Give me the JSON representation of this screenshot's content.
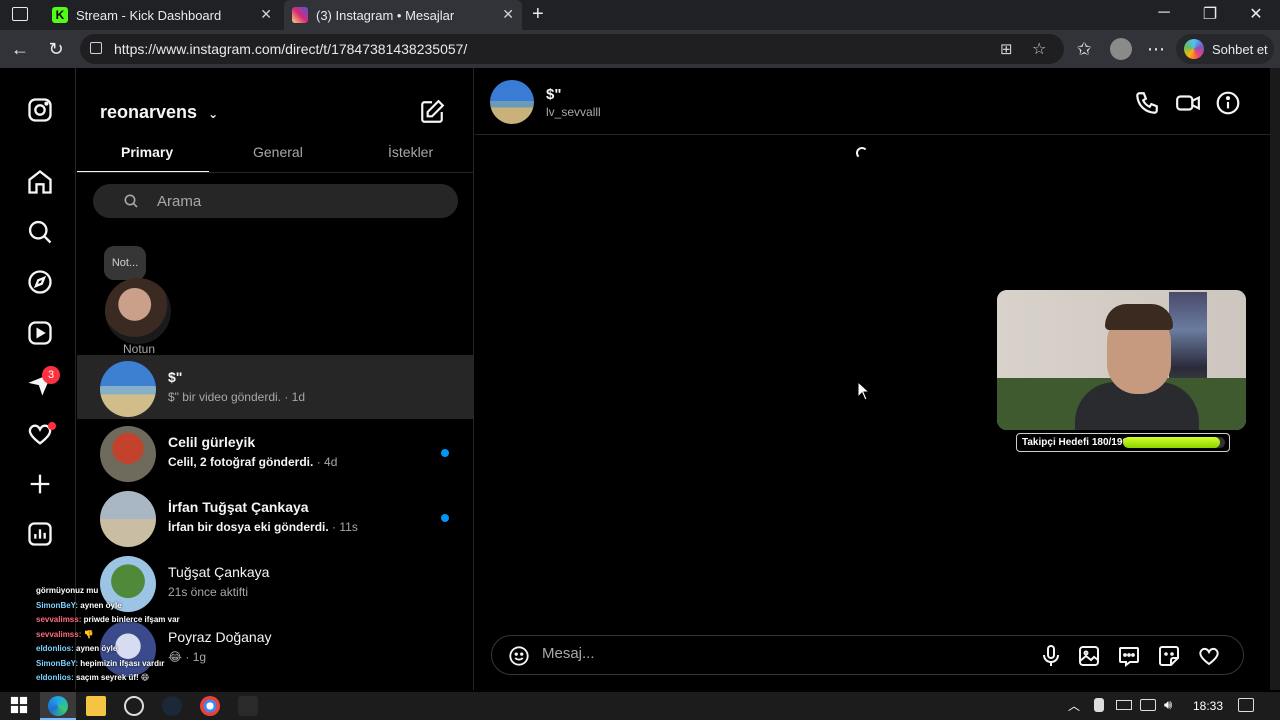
{
  "browser": {
    "tabs": [
      {
        "title": "Stream - Kick Dashboard",
        "active": false
      },
      {
        "title": "(3) Instagram • Mesajlar",
        "active": true
      }
    ],
    "url": "https://www.instagram.com/direct/t/17847381438235057/",
    "copilot_label": "Sohbet et"
  },
  "instagram": {
    "nav": {
      "notifications_badge": "3"
    },
    "inbox": {
      "username": "reonarvens",
      "tabs": [
        "Primary",
        "General",
        "İstekler"
      ],
      "active_tab": "Primary",
      "search_placeholder": "Arama",
      "note": {
        "bubble": "Not...",
        "label": "Notun"
      },
      "conversations": [
        {
          "name": "$\"",
          "preview": "$\" bir video gönderdi.",
          "time": "· 1d",
          "unread": false,
          "active": true
        },
        {
          "name": "Celil gürleyik",
          "preview": "Celil, 2 fotoğraf gönderdi.",
          "time": "· 4d",
          "unread": true,
          "active": false
        },
        {
          "name": "İrfan Tuğşat Çankaya",
          "preview": "İrfan bir dosya eki gönderdi.",
          "time": "· 11s",
          "unread": true,
          "active": false
        },
        {
          "name": "Tuğşat Çankaya",
          "preview": "21s önce aktifti",
          "time": "",
          "unread": false,
          "active": false
        },
        {
          "name": "Poyraz Doğanay",
          "preview": "😂",
          "time": "· 1g",
          "unread": false,
          "active": false
        }
      ]
    },
    "conversation": {
      "title": "$\"",
      "handle": "lv_sevvalll",
      "composer_placeholder": "Mesaj..."
    }
  },
  "stream_overlay": {
    "goal_label": "Takipçi Hedefi 180/190",
    "goal_progress": 0.947,
    "chat": [
      {
        "user": "",
        "text": "görmüyonuz mu",
        "color": "#ffffff"
      },
      {
        "user": "SimonBeY:",
        "text": "aynen öyle",
        "color": "#7cd3ff"
      },
      {
        "user": "sevvalimss:",
        "text": "priwde binlerce ifşam var",
        "color": "#ff6b81"
      },
      {
        "user": "sevvalimss:",
        "text": "👎",
        "color": "#ff6b81"
      },
      {
        "user": "eldonlios:",
        "text": "aynen öyle",
        "color": "#7cd3ff"
      },
      {
        "user": "SimonBeY:",
        "text": "hepimizin ifşası vardır",
        "color": "#7cd3ff"
      },
      {
        "user": "eldonlios:",
        "text": "saçım seyrek üf! 😄",
        "color": "#7cd3ff"
      }
    ]
  },
  "taskbar": {
    "time": "18:33"
  }
}
